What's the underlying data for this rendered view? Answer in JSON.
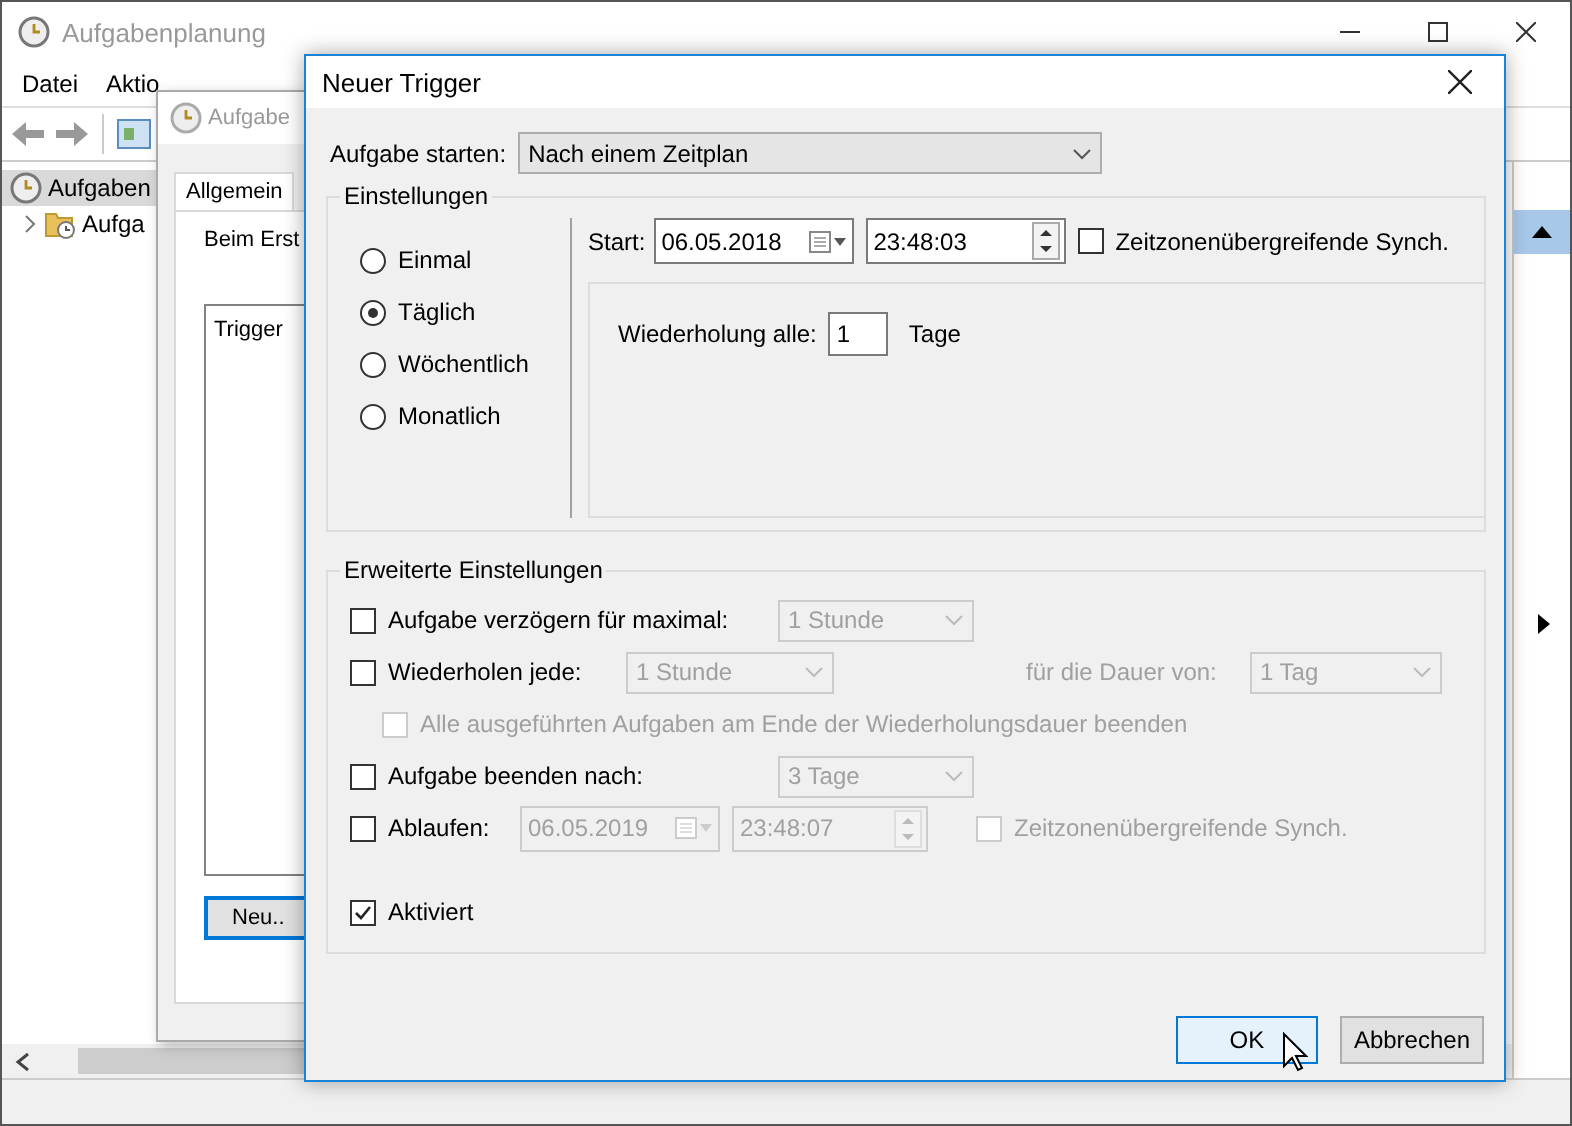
{
  "main_window": {
    "title": "Aufgabenplanung",
    "menu": [
      "Datei",
      "Aktio"
    ],
    "tree": [
      {
        "label": "Aufgaben",
        "selected": true,
        "children": [
          {
            "label": "Aufga",
            "selected": false,
            "expanded": false
          }
        ]
      }
    ]
  },
  "task_window": {
    "title": "Aufgabe",
    "tabs": [
      {
        "label": "Allgemein",
        "selected": true
      }
    ],
    "text": "Beim Erst",
    "list_header": "Trigger",
    "button": "Neu.."
  },
  "dialog": {
    "title": "Neuer Trigger",
    "start_label": "Aufgabe starten:",
    "start_value": "Nach einem Zeitplan",
    "settings": {
      "title": "Einstellungen",
      "schedules": [
        {
          "label": "Einmal",
          "selected": false
        },
        {
          "label": "Täglich",
          "selected": true
        },
        {
          "label": "Wöchentlich",
          "selected": false
        },
        {
          "label": "Monatlich",
          "selected": false
        }
      ],
      "start_label": "Start:",
      "date": "06.05.2018",
      "time": "23:48:03",
      "sync": {
        "label": "Zeitzonenübergreifende Synch.",
        "checked": false
      },
      "repeat_label": "Wiederholung alle:",
      "repeat_value": "1",
      "repeat_unit": "Tage"
    },
    "advanced": {
      "title": "Erweiterte Einstellungen",
      "rows": [
        {
          "kind": "select",
          "label": "Aufgabe verzögern für maximal:",
          "checked": false,
          "value": "1 Stunde"
        },
        {
          "kind": "repeat",
          "label": "Wiederholen jede:",
          "checked": false,
          "value": "1 Stunde",
          "duration_label": "für die Dauer von:",
          "duration_value": "1 Tag"
        },
        {
          "kind": "sub",
          "label": "Alle ausgeführten Aufgaben am Ende der Wiederholungsdauer beenden",
          "checked": false,
          "disabled": true
        },
        {
          "kind": "select",
          "label": "Aufgabe beenden nach:",
          "checked": false,
          "value": "3 Tage"
        },
        {
          "kind": "expire",
          "label": "Ablaufen:",
          "checked": false,
          "date": "06.05.2019",
          "time": "23:48:07",
          "sync": {
            "label": "Zeitzonenübergreifende Synch.",
            "checked": false
          }
        },
        {
          "kind": "plain",
          "label": "Aktiviert",
          "checked": true
        }
      ]
    },
    "buttons": [
      {
        "label": "OK",
        "default": true
      },
      {
        "label": "Abbrechen",
        "default": false
      }
    ]
  }
}
